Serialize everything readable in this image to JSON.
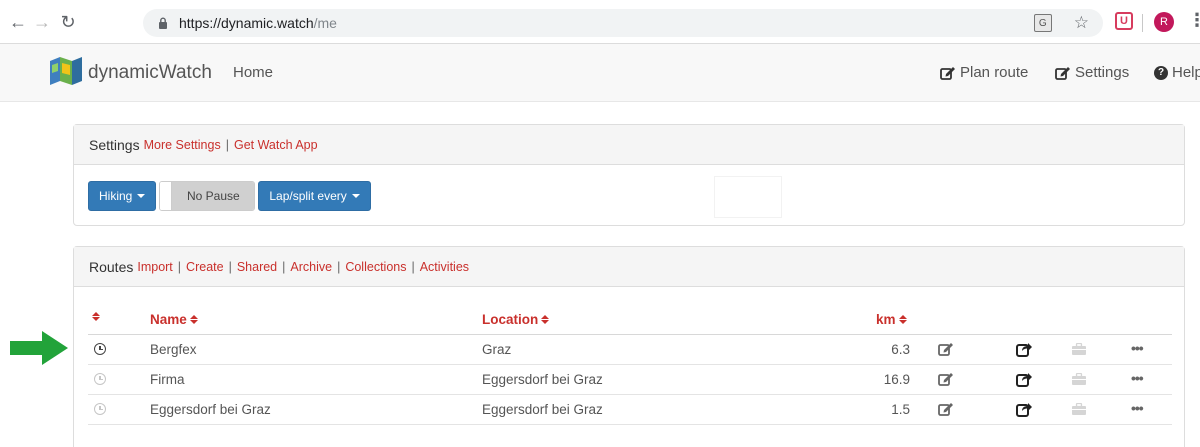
{
  "browser": {
    "url_base": "https://dynamic.watch",
    "url_path": "/me",
    "profile_initial": "R",
    "translate_glyph": "G",
    "extension_glyph": "U"
  },
  "navbar": {
    "brand": "dynamicWatch",
    "home": "Home",
    "plan_route": "Plan route",
    "settings": "Settings",
    "help": "Help"
  },
  "settings_panel": {
    "title": "Settings",
    "link_more": "More Settings",
    "separator": "|",
    "link_watch": "Get Watch App",
    "activity_button": "Hiking",
    "pause_toggle": "No Pause",
    "lap_button": "Lap/split every"
  },
  "routes_panel": {
    "title": "Routes",
    "links": [
      "Import",
      "Create",
      "Shared",
      "Archive",
      "Collections",
      "Activities"
    ],
    "separator": "|",
    "columns": {
      "name": "Name",
      "location": "Location",
      "km": "km"
    },
    "rows": [
      {
        "name": "Bergfex",
        "location": "Graz",
        "km": "6.3",
        "active": true
      },
      {
        "name": "Firma",
        "location": "Eggersdorf bei Graz",
        "km": "16.9",
        "active": false
      },
      {
        "name": "Eggersdorf bei Graz",
        "location": "Eggersdorf bei Graz",
        "km": "1.5",
        "active": false
      }
    ],
    "more_glyph": "•••"
  },
  "colors": {
    "link_red": "#c9302c",
    "button_blue": "#337ab7",
    "arrow_green": "#22a33a"
  }
}
